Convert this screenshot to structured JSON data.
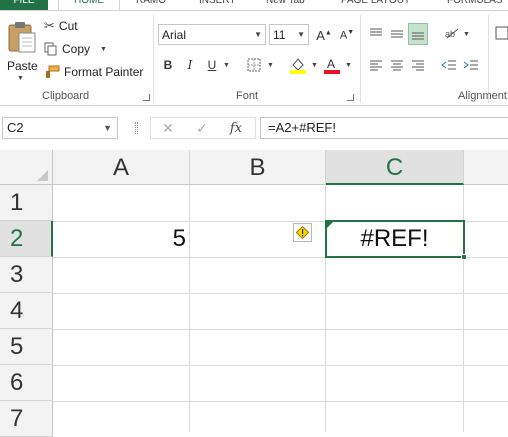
{
  "tabs": [
    {
      "label": "FILE"
    },
    {
      "label": "HOME"
    },
    {
      "label": "RAMO"
    },
    {
      "label": "INSERT"
    },
    {
      "label": "New Tab"
    },
    {
      "label": "PAGE LAYOUT"
    },
    {
      "label": "FORMULAS"
    }
  ],
  "clipboard": {
    "paste_label": "Paste",
    "cut_label": "Cut",
    "copy_label": "Copy",
    "format_painter_label": "Format Painter",
    "group_label": "Clipboard"
  },
  "font": {
    "family_value": "Arial",
    "size_value": "11",
    "bold": "B",
    "italic": "I",
    "underline": "U",
    "group_label": "Font",
    "highlight_color": "#ffff00",
    "font_color": "#e81123"
  },
  "alignment": {
    "group_label": "Alignment"
  },
  "formula_bar": {
    "name_box": "C2",
    "formula": "=A2+#REF!"
  },
  "grid": {
    "columns": [
      "A",
      "B",
      "C"
    ],
    "rows": [
      "1",
      "2",
      "3",
      "4",
      "5",
      "6",
      "7"
    ],
    "cells": {
      "A2": "5",
      "C2": "#REF!"
    },
    "active_cell": "C2"
  },
  "colors": {
    "accent": "#217346",
    "error_warning": "#ffd700"
  }
}
